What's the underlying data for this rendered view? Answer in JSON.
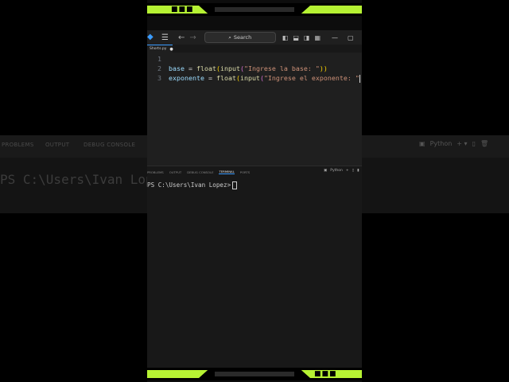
{
  "background": {
    "tabs": [
      "PROBLEMS",
      "OUTPUT",
      "DEBUG CONSOLE"
    ],
    "ps_prompt": "PS C:\\Users\\Ivan Lop",
    "python_label": "Python"
  },
  "titlebar": {
    "search_label": "Search"
  },
  "tab": {
    "filename": "Shorts.py"
  },
  "editor": {
    "lines": [
      {
        "num": "1"
      },
      {
        "num": "2",
        "var": "base",
        "op": " = ",
        "fn1": "float",
        "p1": "(",
        "fn2": "input",
        "p2": "(",
        "str": "\"Ingrese la base: \"",
        "close": "))"
      },
      {
        "num": "3",
        "var": "exponente",
        "op": " = ",
        "fn1": "float",
        "p1": "(",
        "fn2": "input",
        "p2": "(",
        "str": "\"Ingrese el exponente: \""
      }
    ]
  },
  "panel": {
    "tabs": [
      "PROBLEMS",
      "OUTPUT",
      "DEBUG CONSOLE",
      "TERMINAL",
      "PORTS"
    ],
    "active_tab": "TERMINAL",
    "python_label": "Python",
    "terminal_prompt": "PS C:\\Users\\Ivan Lopez>"
  },
  "colors": {
    "accent": "#b6f233",
    "editor_bg": "#1f1f1f",
    "string": "#ce9178",
    "function": "#dcdcaa",
    "variable": "#9cdcfe"
  }
}
